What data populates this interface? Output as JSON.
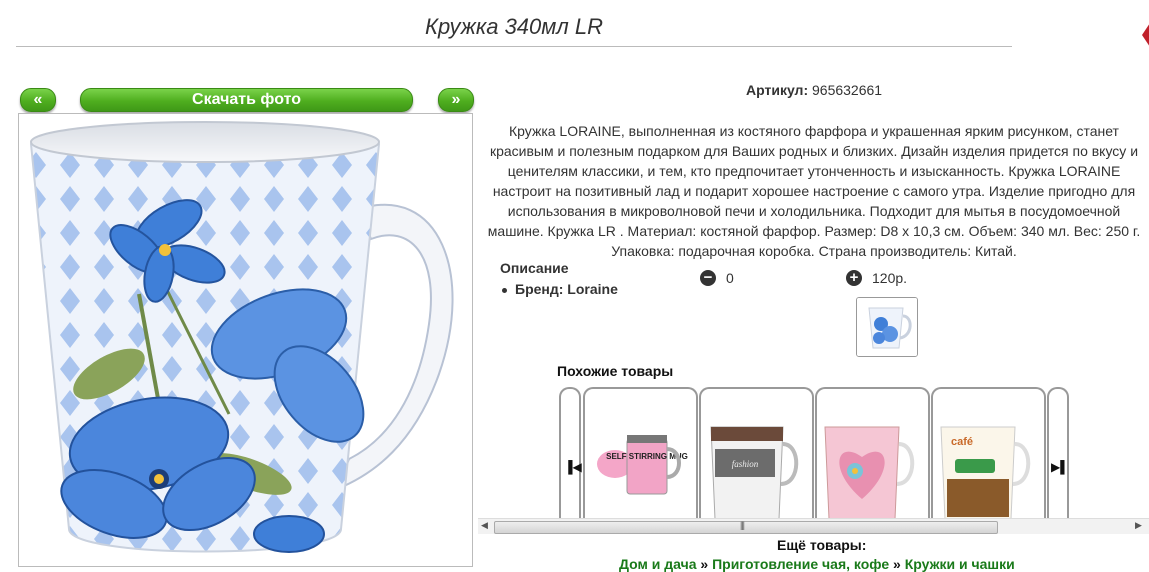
{
  "product": {
    "title": "Кружка 340мл LR",
    "download_label": "Скачать фото",
    "prev_label": "«",
    "next_label": "»",
    "article_label": "Артикул:",
    "article_value": "965632661",
    "description": "Кружка LORAINE, выполненная из костяного фарфора и украшенная ярким рисунком, станет красивым и полезным подарком для Ваших родных и близких. Дизайн изделия придется по вкусу и ценителям классики, и тем, кто предпочитает утонченность и изысканность. Кружка LORAINE настроит на позитивный лад и подарит хорошее настроение с самого утра. Изделие пригодно для использования в микроволновой печи и холодильника. Подходит для мытья в посудомоечной машине. Кружка LR . Материал: костяной фарфор. Размер: D8 х 10,3 см. Объем: 340 мл. Вес: 250 г. Упаковка: подарочная коробка. Страна производитель: Китай.",
    "specs_heading": "Описание",
    "brand_line": "Бренд: Loraine",
    "minus_value": "0",
    "plus_value": "120р."
  },
  "similar": {
    "title": "Похожие товары",
    "items": [
      {
        "caption": "SELF STIRRING MUG"
      },
      {
        "caption": "fashion"
      },
      {
        "caption": "flower heart"
      },
      {
        "caption": "café"
      }
    ]
  },
  "footer": {
    "more_label": "Ещё товары:",
    "crumbs": [
      "Дом и дача",
      "Приготовление чая, кофе",
      "Кружки и чашки"
    ],
    "crumb_sep": "»"
  },
  "colors": {
    "accent_green": "#4fae1f",
    "link_green": "#1a7a1a",
    "mug_blue": "#3f7fd8",
    "corner_red": "#c0202a"
  }
}
